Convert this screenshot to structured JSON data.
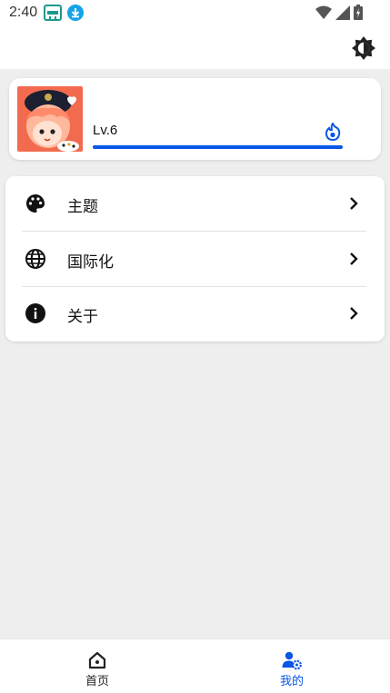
{
  "status_bar": {
    "time": "2:40",
    "left_icons": [
      "app-notification-icon",
      "download-icon"
    ],
    "right_icons": [
      "wifi-icon",
      "signal-icon",
      "battery-icon"
    ]
  },
  "header": {
    "theme_toggle_icon": "brightness-icon"
  },
  "profile": {
    "level": "Lv.6",
    "progress_percent": 100,
    "accent_color": "#0a56e6"
  },
  "menu": {
    "items": [
      {
        "label": "主题",
        "icon": "palette-icon"
      },
      {
        "label": "国际化",
        "icon": "globe-icon"
      },
      {
        "label": "关于",
        "icon": "info-icon"
      }
    ]
  },
  "bottom_nav": {
    "items": [
      {
        "label": "首页",
        "icon": "home-icon",
        "active": false
      },
      {
        "label": "我的",
        "icon": "user-settings-icon",
        "active": true
      }
    ],
    "active_color": "#0a56e6",
    "inactive_color": "#222222"
  }
}
